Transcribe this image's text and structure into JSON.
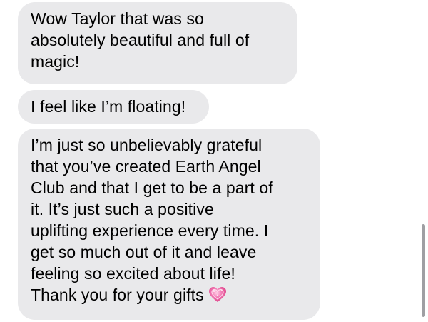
{
  "messages": [
    {
      "text": "Wow Taylor that was so\nabsolutely beautiful and full of\nmagic!"
    },
    {
      "text": "I feel like I’m floating!"
    },
    {
      "text": "I’m just so unbelievably grateful\nthat you’ve created Earth Angel\nClub and that I get to be a part of\nit. It’s just such a positive\nuplifting experience every time. I\nget so much out of it and leave\nfeeling so excited about life!\nThank you for your gifts",
      "emoji": "sparkling-heart-icon"
    }
  ],
  "colors": {
    "bubble_background": "#e9e9eb",
    "text": "#000000",
    "heart": "#e8559b",
    "scrollbar": "#8e8e93"
  }
}
